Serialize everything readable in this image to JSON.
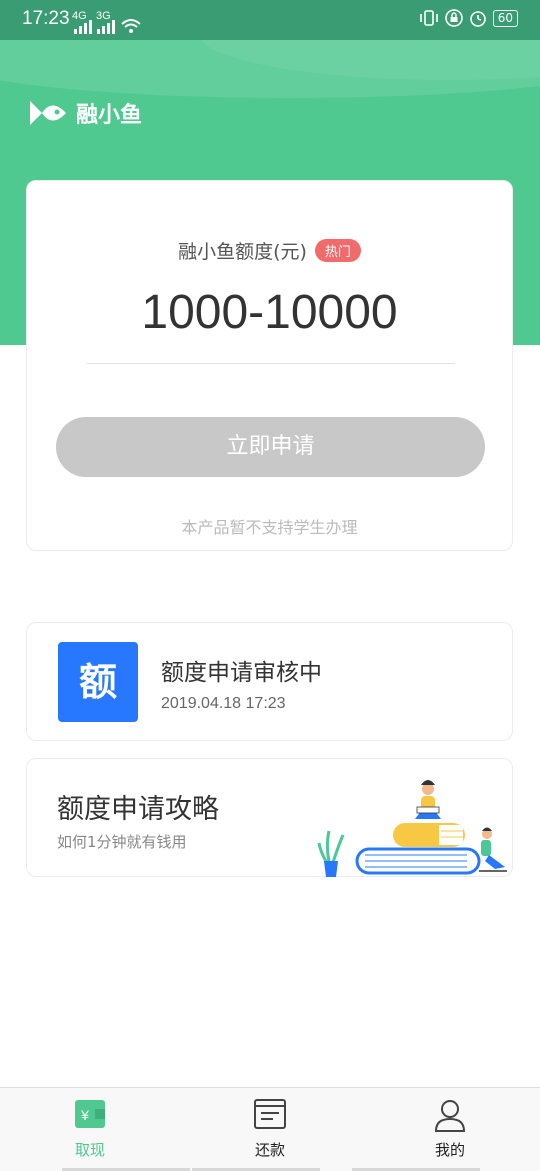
{
  "status_bar": {
    "time": "17:23",
    "signal_1": "4G",
    "signal_2": "3G",
    "battery": "60"
  },
  "brand": {
    "name": "融小鱼",
    "logo_icon": "fish-logo-icon"
  },
  "quota_card": {
    "label": "融小鱼额度(元)",
    "badge": "热门",
    "amount": "1000-10000",
    "apply_button": "立即申请",
    "notice": "本产品暂不支持学生办理"
  },
  "review_card": {
    "icon_text": "额",
    "title": "额度申请审核中",
    "time": "2019.04.18 17:23"
  },
  "guide_card": {
    "title": "额度申请攻略",
    "subtitle": "如何1分钟就有钱用"
  },
  "tabs": [
    {
      "label": "取现",
      "icon": "wallet-icon",
      "active": true
    },
    {
      "label": "还款",
      "icon": "bill-icon",
      "active": false
    },
    {
      "label": "我的",
      "icon": "user-icon",
      "active": false
    }
  ],
  "colors": {
    "brand_green": "#50c990",
    "badge_red": "#f06b6b",
    "icon_blue": "#2878ff",
    "disabled_button": "#c8c8c8"
  }
}
